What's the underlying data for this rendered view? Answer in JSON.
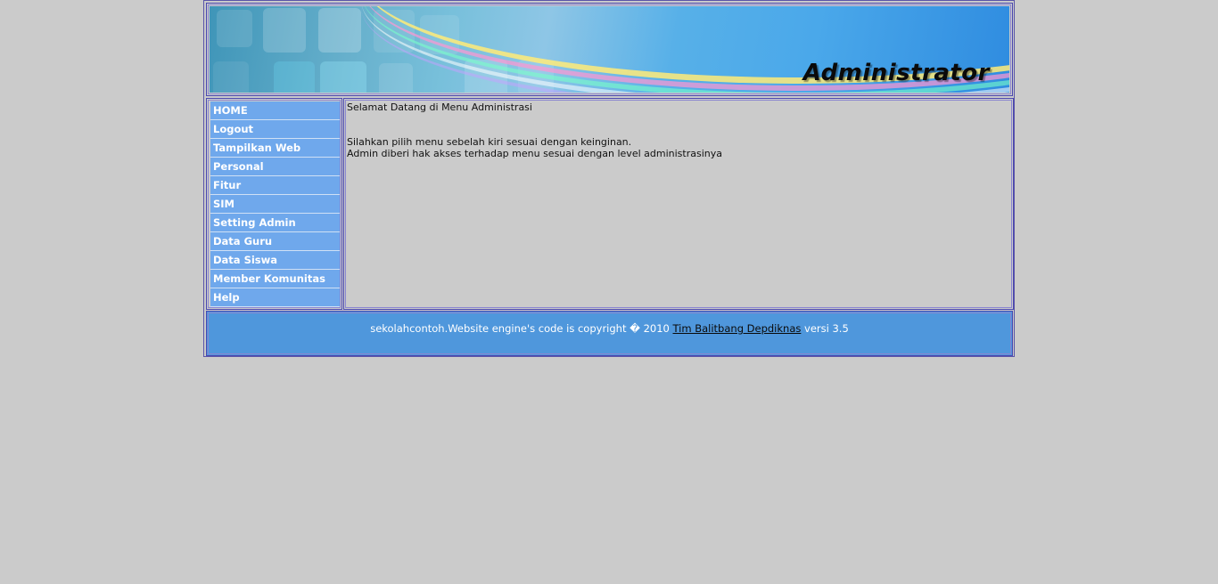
{
  "header": {
    "title": "Administrator"
  },
  "sidebar": {
    "items": [
      {
        "label": "HOME"
      },
      {
        "label": "Logout"
      },
      {
        "label": "Tampilkan Web"
      },
      {
        "label": "Personal"
      },
      {
        "label": "Fitur"
      },
      {
        "label": "SIM"
      },
      {
        "label": "Setting Admin"
      },
      {
        "label": "Data Guru"
      },
      {
        "label": "Data Siswa"
      },
      {
        "label": "Member Komunitas"
      },
      {
        "label": "Help"
      }
    ]
  },
  "main": {
    "welcome": "Selamat Datang di Menu Administrasi",
    "line1": "Silahkan pilih menu sebelah kiri sesuai dengan keinginan.",
    "line2": "Admin diberi hak akses terhadap menu sesuai dengan level administrasinya"
  },
  "footer": {
    "prefix": "sekolahcontoh.Website engine's code is copyright � 2010 ",
    "link": "Tim Balitbang Depdiknas",
    "suffix": " versi 3.5"
  },
  "colors": {
    "background": "#cbcbcb",
    "menu_item": "#6fa8ec",
    "footer": "#4f97dc",
    "border": "#4a47b0"
  }
}
